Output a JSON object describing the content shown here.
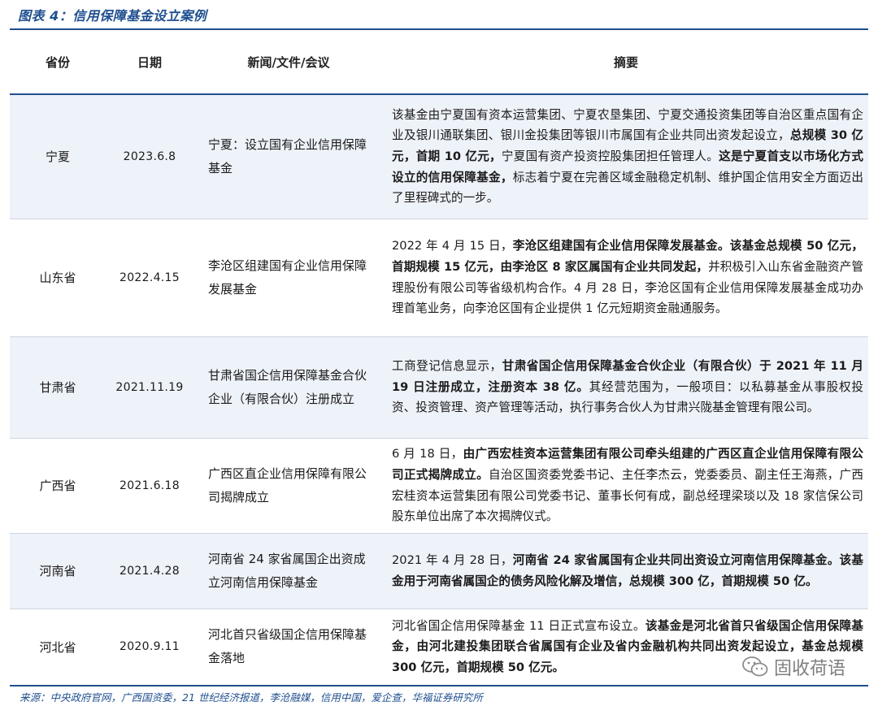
{
  "title": "图表 4：信用保障基金设立案例",
  "headers": {
    "province": "省份",
    "date": "日期",
    "news": "新闻/文件/会议",
    "summary": "摘要"
  },
  "rows": [
    {
      "province": "宁夏",
      "date": "2023.6.8",
      "news": "宁夏：设立国有企业信用保障基金",
      "summary": [
        {
          "t": "该基金由宁夏国有资本运营集团、宁夏农垦集团、宁夏交通投资集团等自治区重点国有企业及银川通联集团、银川金投集团等银川市属国有企业共同出资发起设立，",
          "b": false
        },
        {
          "t": "总规模 30 亿元，首期 10 亿元，",
          "b": true
        },
        {
          "t": "宁夏国有资产投资控股集团担任管理人。",
          "b": false
        },
        {
          "t": "这是宁夏首支以市场化方式设立的信用保障基金，",
          "b": true
        },
        {
          "t": "标志着宁夏在完善区域金融稳定机制、维护国企信用安全方面迈出了里程碑式的一步。",
          "b": false
        }
      ]
    },
    {
      "province": "山东省",
      "date": "2022.4.15",
      "news": "李沧区组建国有企业信用保障发展基金",
      "summary": [
        {
          "t": "2022 年 4 月 15 日，",
          "b": false
        },
        {
          "t": "李沧区组建国有企业信用保障发展基金。该基金总规模 50 亿元，首期规模 15 亿元，由李沧区 8 家区属国有企业共同发起，",
          "b": true
        },
        {
          "t": "并积极引入山东省金融资产管理股份有限公司等省级机构合作。4 月 28 日，李沧区国有企业信用保障发展基金成功办理首笔业务，向李沧区国有企业提供 1 亿元短期资金融通服务。",
          "b": false
        }
      ]
    },
    {
      "province": "甘肃省",
      "date": "2021.11.19",
      "news": "甘肃省国企信用保障基金合伙企业（有限合伙）注册成立",
      "summary": [
        {
          "t": "工商登记信息显示，",
          "b": false
        },
        {
          "t": "甘肃省国企信用保障基金合伙企业（有限合伙）于 2021 年 11 月 19 日注册成立，注册资本 38 亿。",
          "b": true
        },
        {
          "t": "其经营范围为，一般项目：以私募基金从事股权投资、投资管理、资产管理等活动，执行事务合伙人为甘肃兴陇基金管理有限公司。",
          "b": false
        }
      ]
    },
    {
      "province": "广西省",
      "date": "2021.6.18",
      "news": "广西区直企业信用保障有限公司揭牌成立",
      "summary": [
        {
          "t": "6 月 18 日，",
          "b": false
        },
        {
          "t": "由广西宏桂资本运营集团有限公司牵头组建的广西区直企业信用保障有限公司正式揭牌成立。",
          "b": true
        },
        {
          "t": "自治区国资委党委书记、主任李杰云，党委委员、副主任王海燕，广西宏桂资本运营集团有限公司党委书记、董事长何有成，副总经理梁琰以及 18 家信保公司股东单位出席了本次揭牌仪式。",
          "b": false
        }
      ]
    },
    {
      "province": "河南省",
      "date": "2021.4.28",
      "news": "河南省 24 家省属国企出资成立河南信用保障基金",
      "summary": [
        {
          "t": "2021 年 4 月 28 日，",
          "b": false
        },
        {
          "t": "河南省 24 家省属国有企业共同出资设立河南信用保障基金。该基金用于河南省属国企的债务风险化解及增信，总规模 300 亿，首期规模 50 亿。",
          "b": true
        }
      ]
    },
    {
      "province": "河北省",
      "date": "2020.9.11",
      "news": "河北首只省级国企信用保障基金落地",
      "summary": [
        {
          "t": "河北省国企信用保障基金 11 日正式宣布设立。",
          "b": false
        },
        {
          "t": "该基金是河北省首只省级国企信用保障基金，由河北建投集团联合省属国有企业及省内金融机构共同出资发起设立，基金总规模 300 亿元，首期规模 50 亿元。",
          "b": true
        }
      ]
    }
  ],
  "source": "来源：中央政府官网，广西国资委，21 世纪经济报道，李沧融媒，信用中国，爱企查，华福证券研究所",
  "watermark": "固收荷语"
}
